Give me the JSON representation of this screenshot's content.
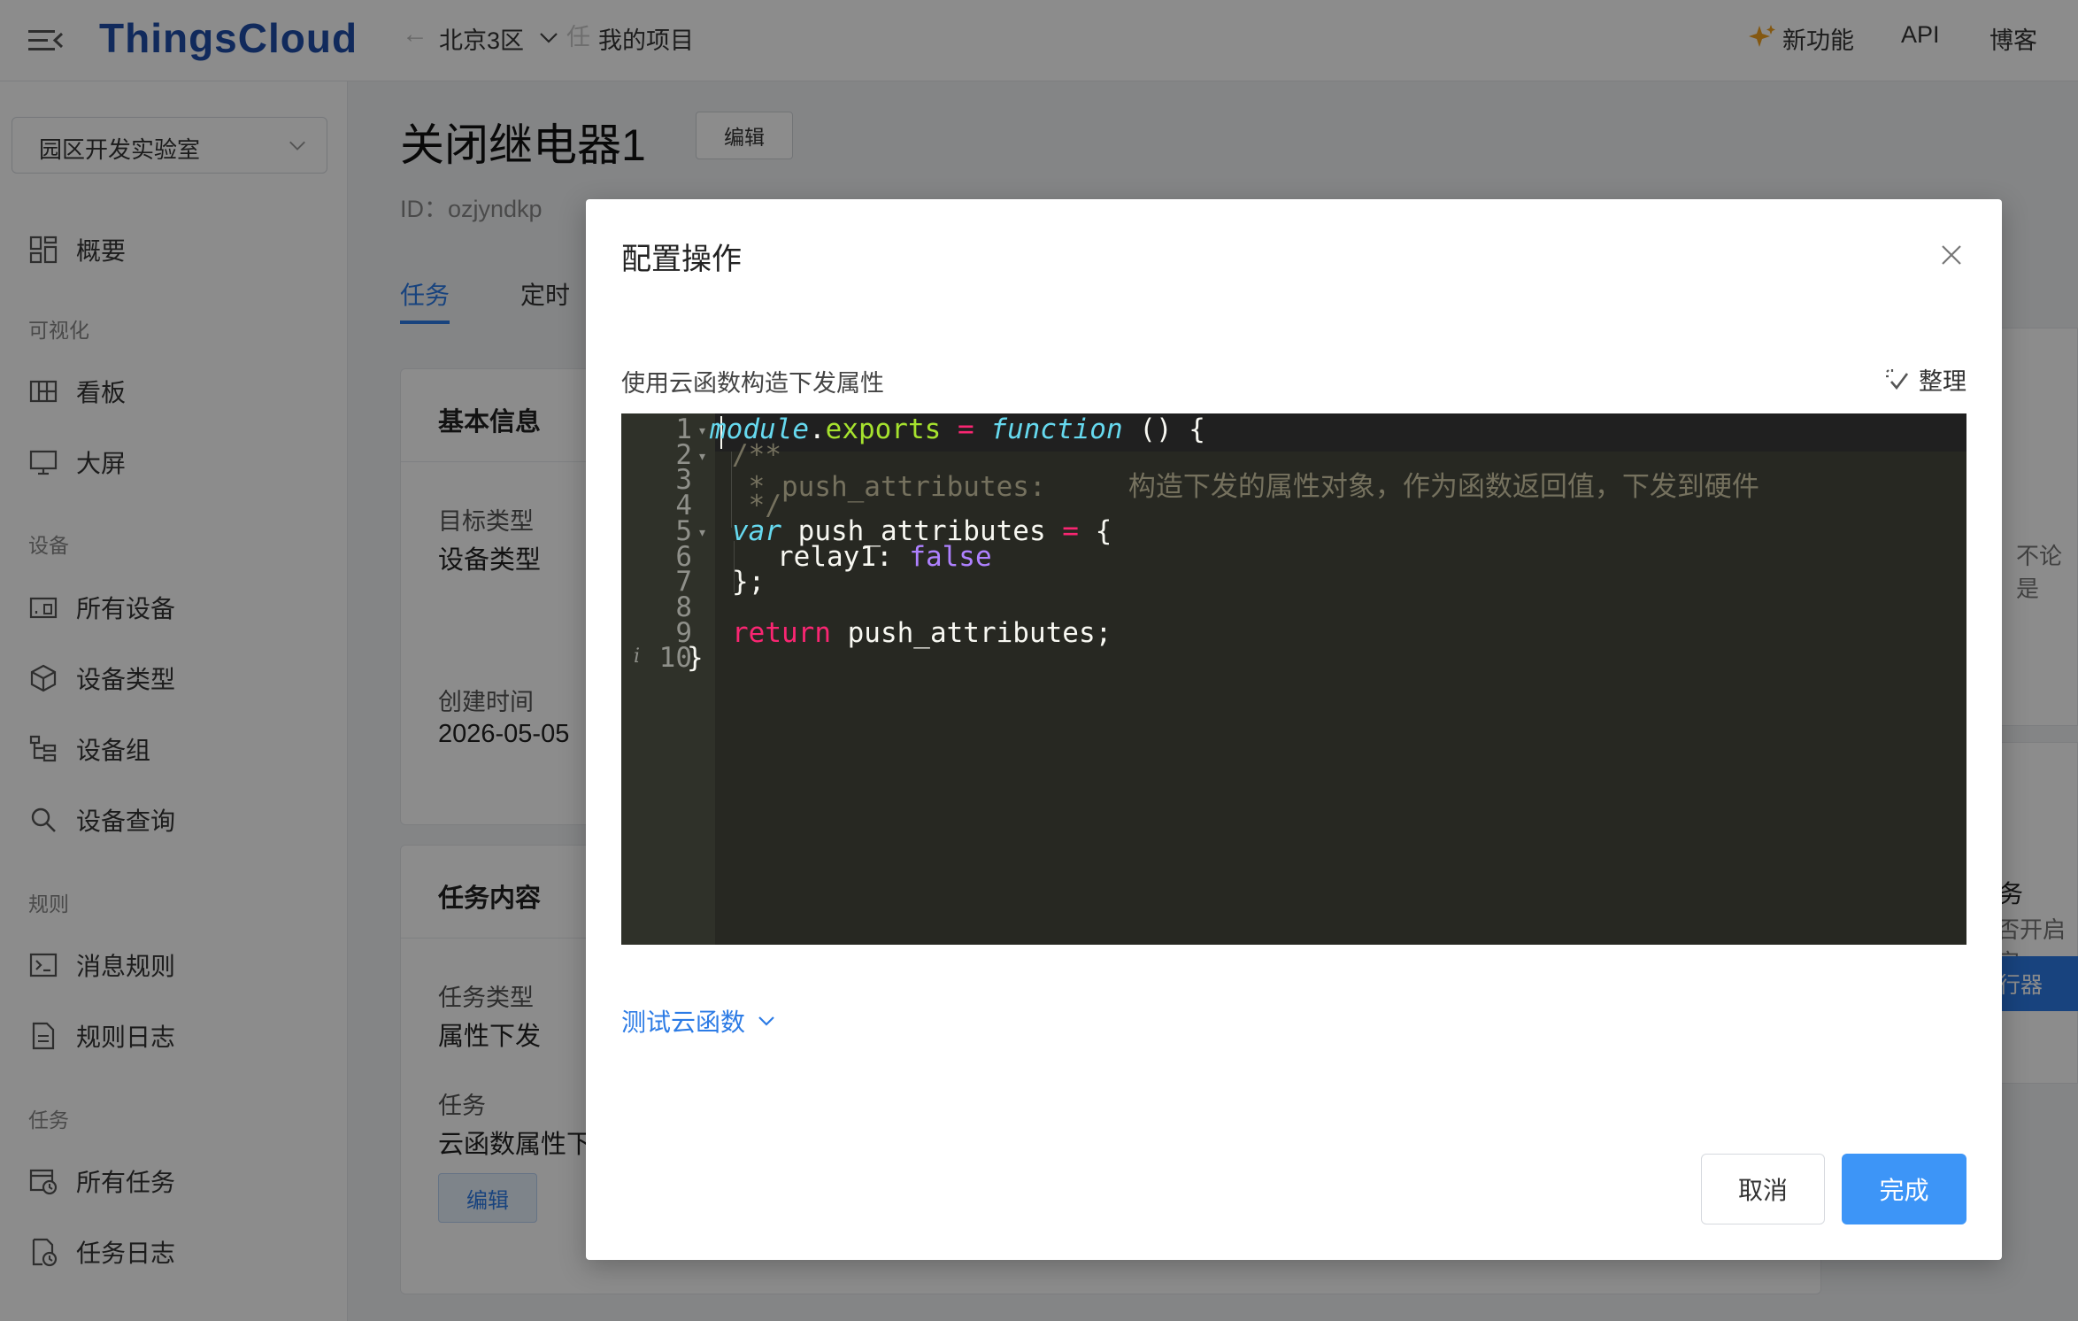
{
  "header": {
    "logo": "ThingsCloud",
    "region": "北京3区",
    "breadcrumb_faded": "任",
    "project": "我的项目",
    "new_features": "新功能",
    "api": "API",
    "blog": "博客"
  },
  "sidebar": {
    "project_select": "园区开发实验室",
    "overview": "概要",
    "group_visual": "可视化",
    "dashboard": "看板",
    "big_screen": "大屏",
    "group_devices": "设备",
    "all_devices": "所有设备",
    "device_types": "设备类型",
    "device_groups": "设备组",
    "device_query": "设备查询",
    "group_rules": "规则",
    "message_rules": "消息规则",
    "rule_logs": "规则日志",
    "group_tasks": "任务",
    "all_tasks": "所有任务",
    "task_logs": "任务日志"
  },
  "main": {
    "title": "关闭继电器1",
    "edit": "编辑",
    "id": "ID：ozjyndkp",
    "tabs": [
      "任务",
      "定时"
    ],
    "basic_info_title": "基本信息",
    "target_type_label": "目标类型",
    "target_type_value": "设备类型",
    "created_label": "创建时间",
    "created_value": "2026-05-05",
    "task_content_title": "任务内容",
    "task_type_label": "任务类型",
    "task_type_value": "属性下发",
    "task_label": "任务",
    "task_value": "云函数属性下发",
    "edit_small": "编辑",
    "right_text_1": "不论是",
    "right_text_2": "务",
    "right_text_3": "否开启定",
    "right_btn": "行器"
  },
  "modal": {
    "title": "配置操作",
    "code_label": "使用云函数构造下发属性",
    "format": "整理",
    "line_numbers": [
      "1",
      "2",
      "3",
      "4",
      "5",
      "6",
      "7",
      "8",
      "9",
      "10"
    ],
    "code": {
      "l1_module": "module",
      "l1_dot": ".",
      "l1_exports": "exports",
      "l1_eq": " = ",
      "l1_function": "function",
      "l1_rest": " () {",
      "l2": "/**",
      "l3": " * push_attributes:     构造下发的属性对象，作为函数返回值，下发到硬件",
      "l4": " */",
      "l5_var": "var",
      "l5_name": " push_attributes ",
      "l5_eq": "=",
      "l5_brace": " {",
      "l6_key": "relay1: ",
      "l6_val": "false",
      "l7": "};",
      "l9_return": "return",
      "l9_rest": " push_attributes;",
      "l10": "}"
    },
    "test_fn": "测试云函数",
    "cancel": "取消",
    "done": "完成"
  },
  "colors": {
    "brand_blue": "#1f4ea8",
    "primary": "#2c7be5",
    "button_primary": "#3d95f7",
    "editor_bg": "#272822"
  }
}
